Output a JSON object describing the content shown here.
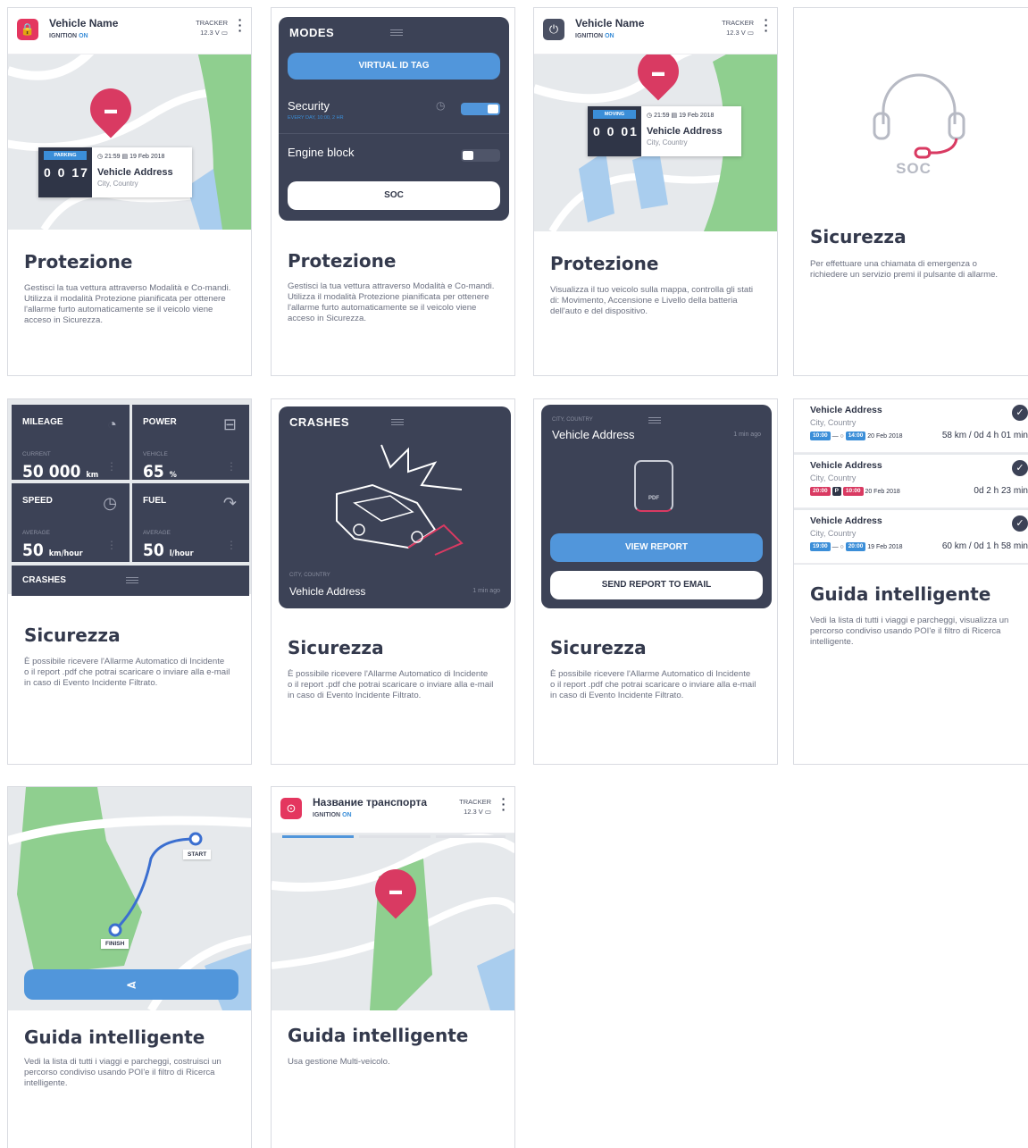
{
  "common": {
    "vehicle_name": "Vehicle Name",
    "ignition_label": "IGNITION",
    "ignition_state": "ON",
    "tracker_label": "TRACKER",
    "voltage": "12.3 V",
    "address": "Vehicle Address",
    "city": "City, Country",
    "time": "21:59",
    "date": "19 Feb 2018"
  },
  "s1": {
    "status": "PARKING",
    "counter": "0 0 17",
    "title": "Protezione",
    "text": "Gestisci la tua vettura attraverso Modalità e Co-mandi. Utilizza il modalità Protezione pianificata per ottenere l'allarme furto automaticamente se il veicolo viene acceso in Sicurezza."
  },
  "s2": {
    "panel_title": "MODES",
    "virtual_tag": "VIRTUAL ID TAG",
    "security_label": "Security",
    "security_sub": "EVERY DAY, 10:00, 2 HR",
    "engine_label": "Engine block",
    "soc_label": "SOC",
    "title": "Protezione",
    "text": "Gestisci la tua vettura attraverso Modalità e Co-mandi. Utilizza il modalità Protezione pianificata per ottenere l'allarme furto automaticamente se il veicolo viene acceso in Sicurezza."
  },
  "s3": {
    "status": "MOVING",
    "counter": "0 0 01",
    "title": "Protezione",
    "text": "Visualizza il tuo veicolo sulla mappa, controlla gli stati di: Movimento, Accensione e Livello della batteria dell'auto e del dispositivo."
  },
  "s4": {
    "soc_label": "SOC",
    "title": "Sicurezza",
    "text": "Per effettuare una chiamata di emergenza o richiedere un servizio premi il pulsante di allarme."
  },
  "s5": {
    "tiles": [
      {
        "title": "MILEAGE",
        "sub": "CURRENT",
        "value": "50 000",
        "unit": "km"
      },
      {
        "title": "POWER",
        "sub": "VEHICLE",
        "value": "65",
        "unit": "%"
      },
      {
        "title": "SPEED",
        "sub": "AVERAGE",
        "value": "50",
        "unit": "km/hour"
      },
      {
        "title": "FUEL",
        "sub": "AVERAGE",
        "value": "50",
        "unit": "l/hour"
      }
    ],
    "crashes_label": "CRASHES",
    "title": "Sicurezza",
    "text": "È possibile ricevere l'Allarme Automatico di Incidente o il report .pdf che potrai scaricare o inviare alla e-mail in caso di Evento Incidente Filtrato."
  },
  "s6": {
    "panel_title": "CRASHES",
    "city": "CITY, COUNTRY",
    "address": "Vehicle Address",
    "ago": "1 min ago",
    "title": "Sicurezza",
    "text": "È possibile ricevere l'Allarme Automatico di Incidente o il report .pdf che potrai scaricare o inviare alla e-mail in caso di Evento Incidente Filtrato."
  },
  "s7": {
    "city": "CITY, COUNTRY",
    "address": "Vehicle Address",
    "ago": "1 min ago",
    "file_label": "PDF",
    "view_report": "VIEW REPORT",
    "send_report": "SEND REPORT TO EMAIL",
    "title": "Sicurezza",
    "text": "È possibile ricevere l'Allarme Automatico di Incidente o il report .pdf che potrai scaricare o inviare alla e-mail in caso di Evento Incidente Filtrato."
  },
  "s8": {
    "trips": [
      {
        "address": "Vehicle Address",
        "city": "City, Country",
        "start": "10:00",
        "end": "14:00",
        "date": "20 Feb 2018",
        "summary": "58 km / 0d 4 h 01 min"
      },
      {
        "address": "Vehicle Address",
        "city": "City, Country",
        "start": "20:00",
        "parking": "P",
        "end": "10:00",
        "date": "20 Feb 2018",
        "summary": "0d 2 h 23 min"
      },
      {
        "address": "Vehicle Address",
        "city": "City, Country",
        "start": "19:00",
        "end": "20:00",
        "date": "19 Feb 2018",
        "summary": "60 km / 0d 1 h 58 min"
      }
    ],
    "title": "Guida intelligente",
    "text": "Vedi la lista di tutti i viaggi e parcheggi, visualizza un percorso condiviso usando POI'e il filtro di Ricerca intelligente."
  },
  "s9": {
    "start_label": "START",
    "finish_label": "FINISH",
    "title": "Guida intelligente",
    "text": "Vedi la lista di tutti i viaggi e parcheggi, costruisci un percorso condiviso usando POI'e il filtro di Ricerca intelligente."
  },
  "s10": {
    "vehicle_name": "Название транспорта",
    "title": "Guida intelligente",
    "text": "Usa gestione Multi-veicolo."
  },
  "colors": {
    "accent": "#5196db",
    "brand": "#d93a62",
    "dark": "#3c4256",
    "map_green": "#8fcf8f",
    "map_blue": "#a9cdee"
  }
}
